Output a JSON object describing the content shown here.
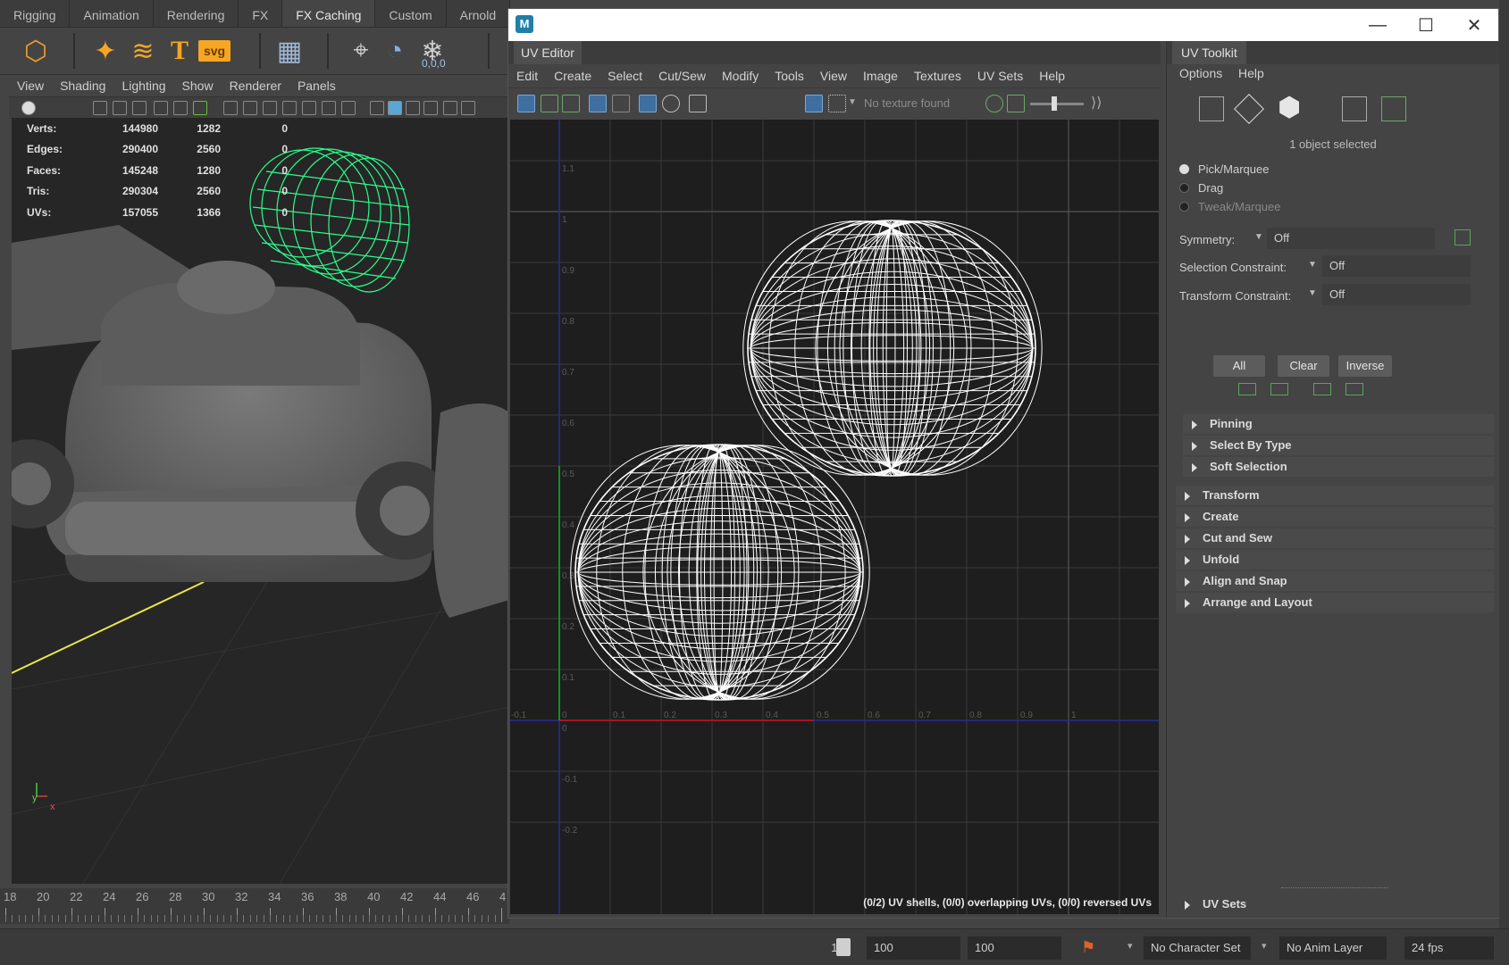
{
  "shelf_tabs": [
    "Rigging",
    "Animation",
    "Rendering",
    "FX",
    "FX Caching",
    "Custom",
    "Arnold"
  ],
  "shelf_active": "FX Caching",
  "shelf_icons": [
    {
      "name": "polyhedron-icon",
      "glyph": "⬡",
      "color": "#e89b2e"
    },
    {
      "name": "sparkle-icon",
      "glyph": "✦",
      "color": "#f5a623"
    },
    {
      "name": "curve-icon",
      "glyph": "≋",
      "color": "#f5a623"
    },
    {
      "name": "type-icon",
      "glyph": "T",
      "color": "#f5a623"
    },
    {
      "name": "svg-icon",
      "glyph": "svg",
      "color": "#f5a623"
    },
    {
      "name": "grid-calendar-icon",
      "glyph": "▦",
      "color": "#9fb8d6"
    },
    {
      "name": "locator-icon",
      "glyph": "⌖",
      "color": "#cfcfcf"
    },
    {
      "name": "measure-icon",
      "glyph": "◔",
      "color": "#7fb2e5"
    },
    {
      "name": "snowflake-icon",
      "glyph": "❄",
      "color": "#cfcfcf"
    }
  ],
  "shelf_snowflake_label": "0,0,0",
  "viewport": {
    "menu": [
      "View",
      "Shading",
      "Lighting",
      "Show",
      "Renderer",
      "Panels"
    ],
    "hud": [
      {
        "label": "Verts:",
        "a": "144980",
        "b": "1282",
        "c": "0"
      },
      {
        "label": "Edges:",
        "a": "290400",
        "b": "2560",
        "c": "0"
      },
      {
        "label": "Faces:",
        "a": "145248",
        "b": "1280",
        "c": "0"
      },
      {
        "label": "Tris:",
        "a": "290304",
        "b": "2560",
        "c": "0"
      },
      {
        "label": "UVs:",
        "a": "157055",
        "b": "1366",
        "c": "0"
      }
    ],
    "axis_y": "y",
    "axis_x": "x"
  },
  "timeline_ticks": [
    "18",
    "20",
    "22",
    "24",
    "26",
    "28",
    "30",
    "32",
    "34",
    "36",
    "38",
    "40",
    "42",
    "44",
    "46",
    "4"
  ],
  "bottom_bar": {
    "field1": "100",
    "field2": "100",
    "field3": "100",
    "character_set": "No Character Set",
    "anim_layer": "No Anim Layer",
    "fps": "24 fps"
  },
  "uv_editor": {
    "window_title": "",
    "tab_title": "UV Editor",
    "menu": [
      "Edit",
      "Create",
      "Select",
      "Cut/Sew",
      "Modify",
      "Tools",
      "View",
      "Image",
      "Textures",
      "UV Sets",
      "Help"
    ],
    "texture_label": "No texture found",
    "status": "(0/2) UV shells, (0/0) overlapping UVs, (0/0) reversed UVs",
    "grid_labels_x": [
      "-0.1",
      "0",
      "0.1",
      "0.2",
      "0.3",
      "0.4",
      "0.5",
      "0.6",
      "0.7",
      "0.8",
      "0.9",
      "1"
    ],
    "grid_labels_y": [
      "1.1",
      "1",
      "0.9",
      "0.8",
      "0.7",
      "0.6",
      "0.5",
      "0.4",
      "0.3",
      "0.2",
      "0.1",
      "0",
      "-0.1",
      "-0.2"
    ],
    "colors": {
      "u_axis": "#d01010",
      "v_axis": "#10b010",
      "udim_line": "#2a2aa0",
      "wire": "#ffffff"
    }
  },
  "toolkit": {
    "tab_title": "UV Toolkit",
    "menu": [
      "Options",
      "Help"
    ],
    "selection_info": "1 object selected",
    "modes": [
      {
        "label": "Pick/Marquee",
        "on": true
      },
      {
        "label": "Drag",
        "on": false
      },
      {
        "label": "Tweak/Marquee",
        "on": false
      }
    ],
    "symmetry_label": "Symmetry:",
    "symmetry_value": "Off",
    "selection_constraint_label": "Selection Constraint:",
    "selection_constraint_value": "Off",
    "transform_constraint_label": "Transform Constraint:",
    "transform_constraint_value": "Off",
    "buttons": [
      "All",
      "Clear",
      "Inverse"
    ],
    "subsections": [
      "Pinning",
      "Select By Type",
      "Soft Selection"
    ],
    "sections": [
      "Transform",
      "Create",
      "Cut and Sew",
      "Unfold",
      "Align and Snap",
      "Arrange and Layout"
    ],
    "bottom_section": "UV Sets"
  }
}
